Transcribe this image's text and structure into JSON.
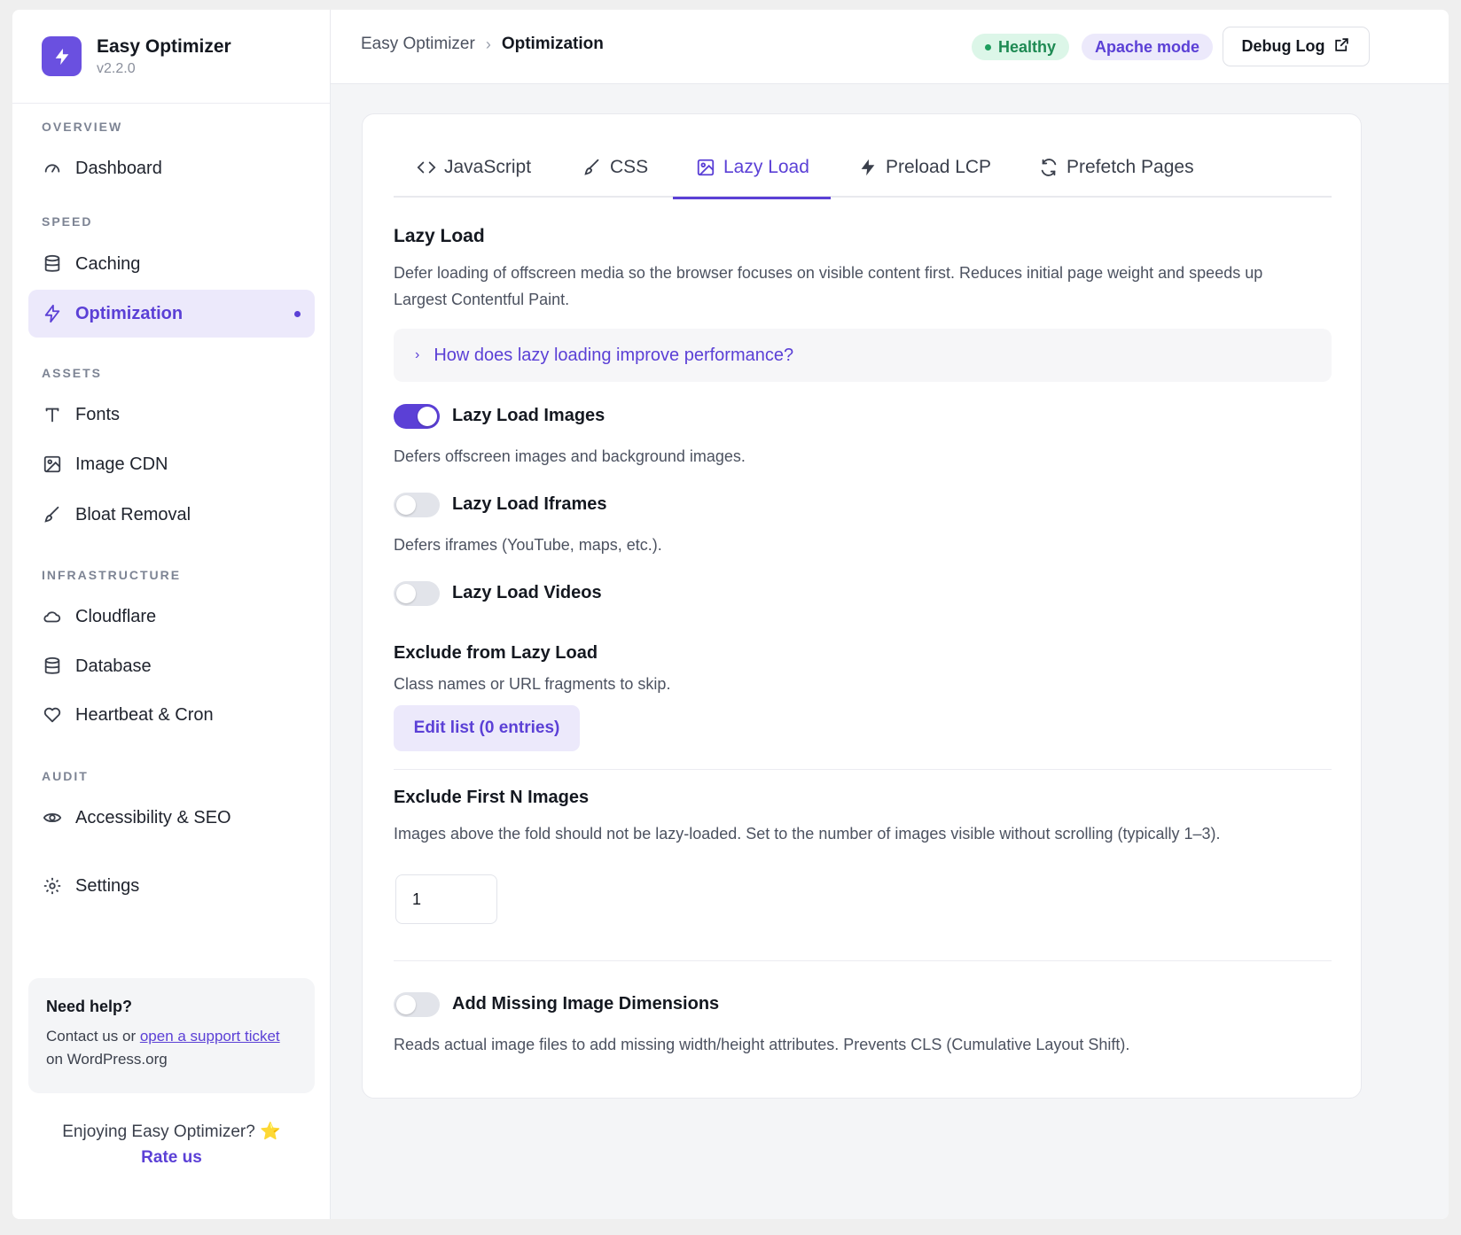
{
  "brand": {
    "name": "Easy Optimizer",
    "version": "v2.2.0"
  },
  "sidebar": {
    "sections": {
      "overview": "OVERVIEW",
      "speed": "SPEED",
      "assets": "ASSETS",
      "infrastructure": "INFRASTRUCTURE",
      "audit": "AUDIT"
    },
    "items": {
      "dashboard": "Dashboard",
      "caching": "Caching",
      "optimization": "Optimization",
      "fonts": "Fonts",
      "image_cdn": "Image CDN",
      "bloat_removal": "Bloat Removal",
      "cloudflare": "Cloudflare",
      "database": "Database",
      "heartbeat": "Heartbeat & Cron",
      "accessibility": "Accessibility & SEO",
      "settings": "Settings"
    },
    "active": "optimization",
    "help": {
      "title": "Need help?",
      "text_before": "Contact us or ",
      "link": "open a support ticket",
      "text_after": " on WordPress.org"
    },
    "enjoy": "Enjoying Easy Optimizer? ⭐",
    "rate": "Rate us"
  },
  "topbar": {
    "breadcrumb_root": "Easy Optimizer",
    "breadcrumb_current": "Optimization",
    "status_badge": "Healthy",
    "mode_badge": "Apache mode",
    "debug_button": "Debug Log"
  },
  "tabs": [
    {
      "label": "JavaScript",
      "icon": "code-icon"
    },
    {
      "label": "CSS",
      "icon": "brush-icon"
    },
    {
      "label": "Lazy Load",
      "icon": "image-icon"
    },
    {
      "label": "Preload LCP",
      "icon": "bolt-icon"
    },
    {
      "label": "Prefetch Pages",
      "icon": "refresh-icon"
    }
  ],
  "active_tab": "Lazy Load",
  "lazy_load": {
    "title": "Lazy Load",
    "description": "Defer loading of offscreen media so the browser focuses on visible content first. Reduces initial page weight and speeds up Largest Contentful Paint.",
    "faq": "How does lazy loading improve performance?",
    "images": {
      "label": "Lazy Load Images",
      "desc": "Defers offscreen images and background images.",
      "enabled": true
    },
    "iframes": {
      "label": "Lazy Load Iframes",
      "desc": "Defers iframes (YouTube, maps, etc.).",
      "enabled": false
    },
    "videos": {
      "label": "Lazy Load Videos",
      "enabled": false
    },
    "exclude": {
      "title": "Exclude from Lazy Load",
      "desc": "Class names or URL fragments to skip.",
      "button": "Edit list (0 entries)"
    },
    "exclude_first": {
      "title": "Exclude First N Images",
      "desc": "Images above the fold should not be lazy-loaded. Set to the number of images visible without scrolling (typically 1–3).",
      "value": "1"
    },
    "dimensions": {
      "label": "Add Missing Image Dimensions",
      "desc": "Reads actual image files to add missing width/height attributes. Prevents CLS (Cumulative Layout Shift).",
      "enabled": false
    }
  },
  "colors": {
    "accent": "#5b40d6",
    "accent_soft": "#ece9fb",
    "healthy": "#1e8a53"
  }
}
